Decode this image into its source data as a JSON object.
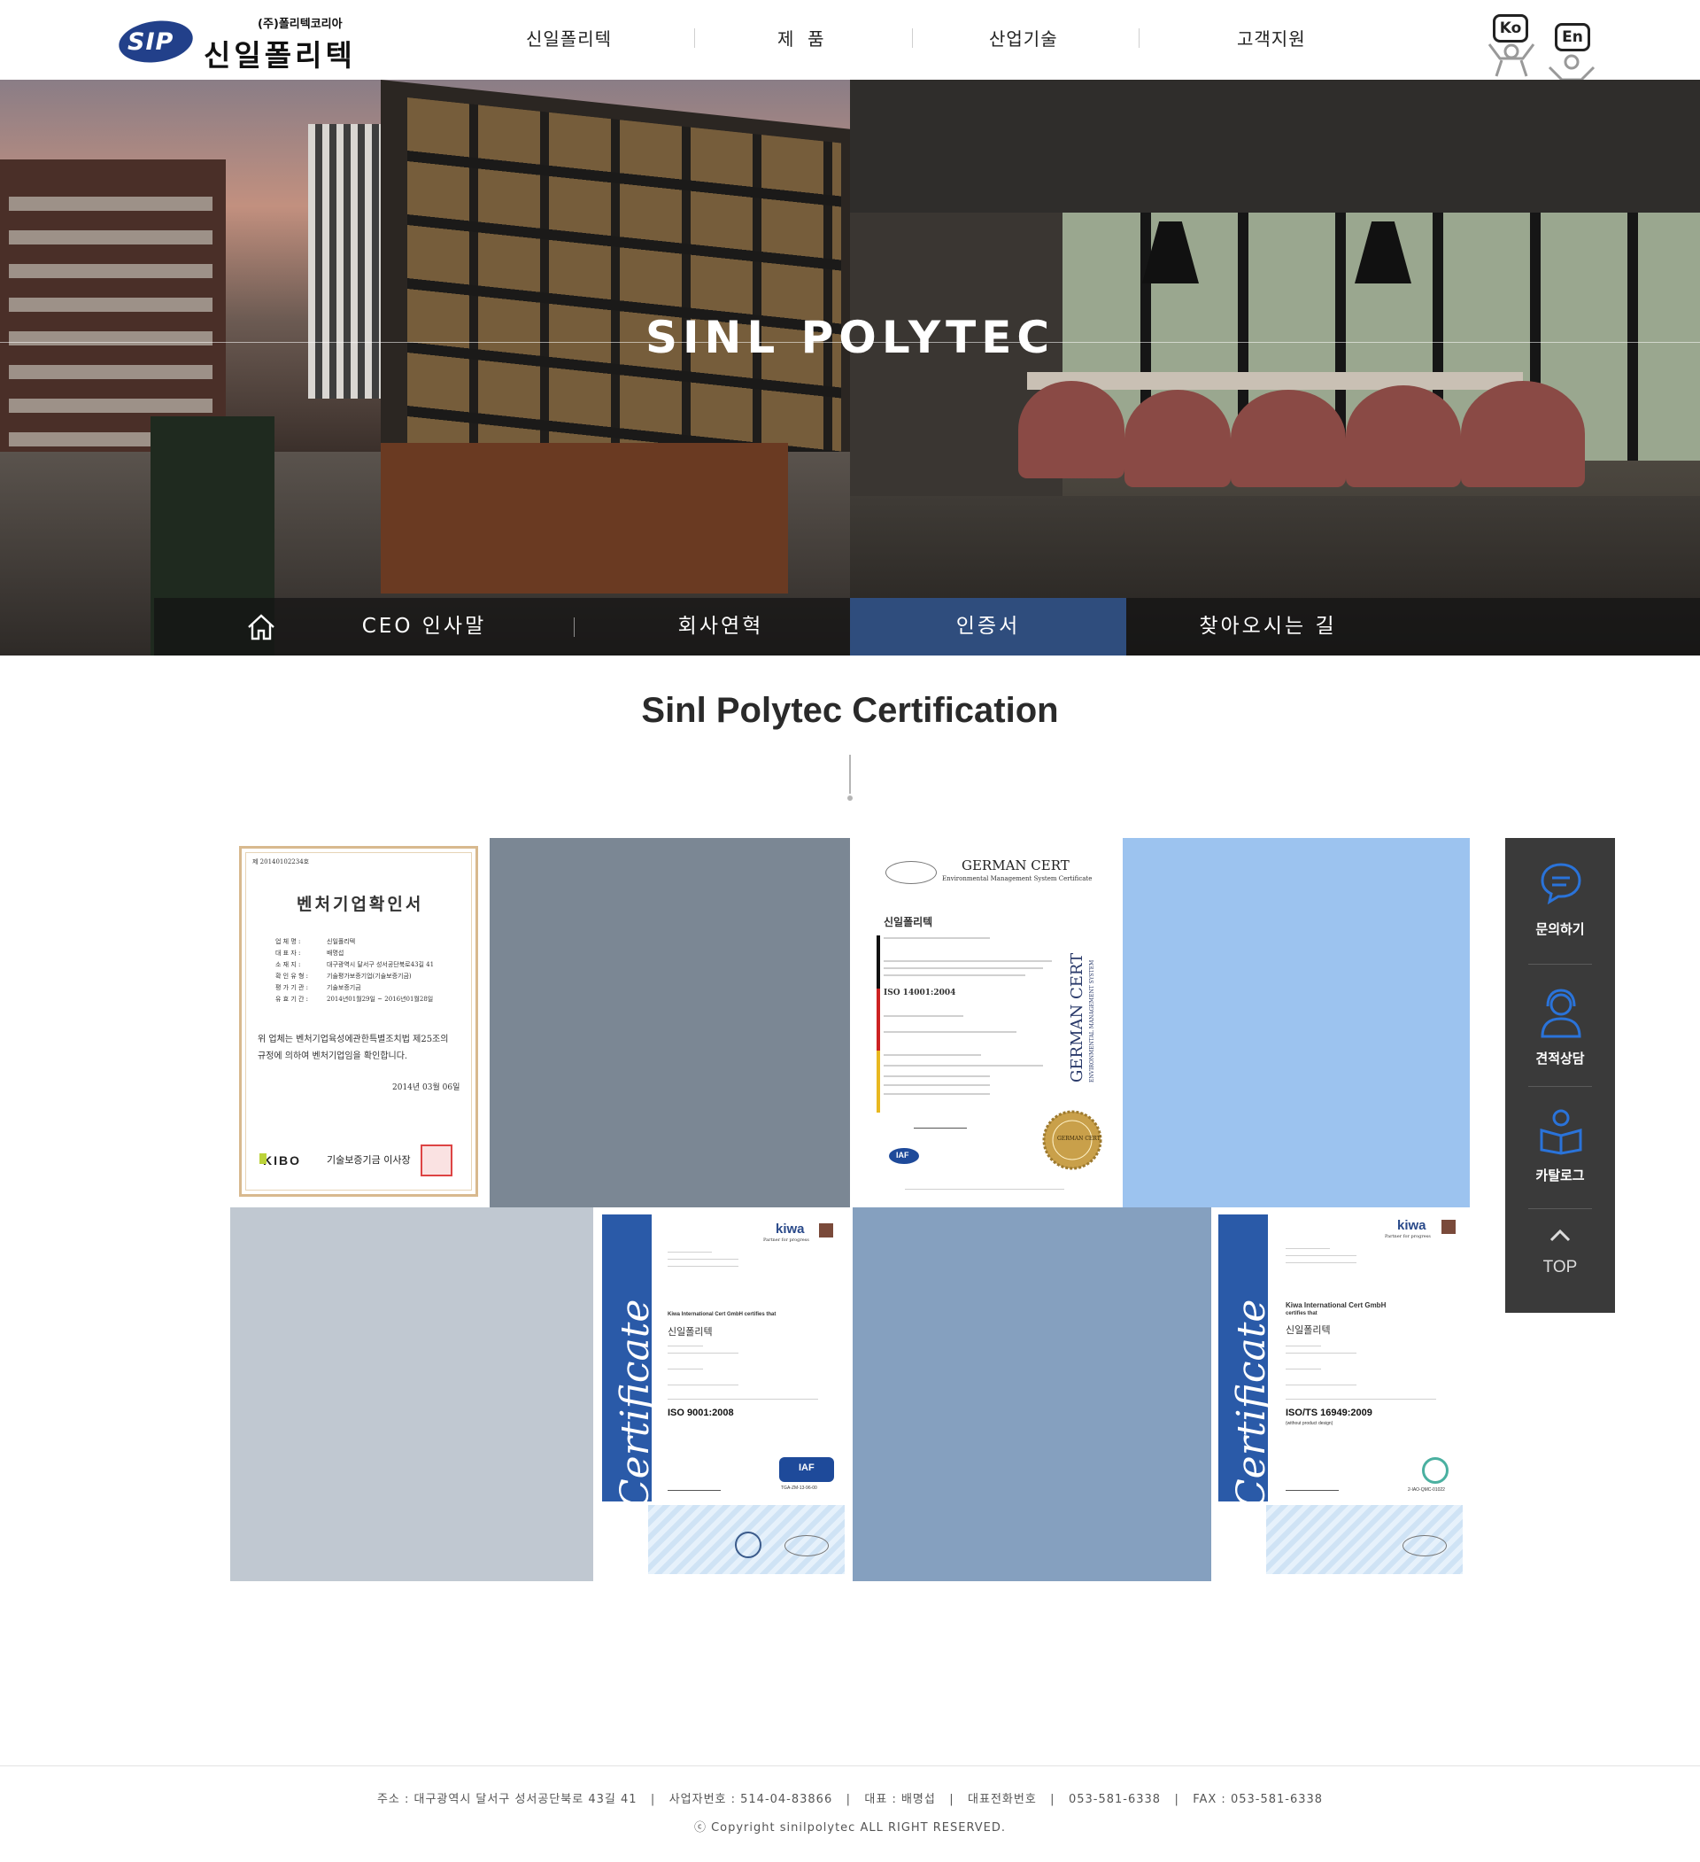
{
  "header": {
    "logo": {
      "badge": "SIP",
      "corp": "(주)폴리텍코리아",
      "name": "신일폴리텍"
    },
    "nav": [
      "신일폴리텍",
      "제  품",
      "산업기술",
      "고객지원"
    ],
    "lang": [
      "Ko",
      "En"
    ]
  },
  "hero": {
    "title": "SINL POLYTEC",
    "subnav": [
      "CEO 인사말",
      "회사연혁",
      "인증서",
      "찾아오시는 길"
    ],
    "active_index": 2
  },
  "content": {
    "title": "Sinl Polytec Certification",
    "tile_colors": [
      "#7b8794",
      "#9cc3ef",
      "#c0c8d1",
      "#85a0bf"
    ],
    "certs": {
      "venture": {
        "number": "제   20140102234호",
        "title": "벤처기업확인서",
        "rows": [
          [
            "업   체   명 :",
            "신일폴리텍"
          ],
          [
            "대   표   자 :",
            "배명섭"
          ],
          [
            "소   재   지 :",
            "대구광역시 달서구 성서공단북로43길 41"
          ],
          [
            "확 인 유 형 :",
            "기술평가보증기업(기술보증기금)"
          ],
          [
            "평 가 기 관 :",
            "기술보증기금"
          ],
          [
            "유 효 기 간 :",
            "2014년01월29일 ~ 2016년01월28일"
          ]
        ],
        "body1": "위 업체는 벤처기업육성에관한특별조치법 제25조의",
        "body2": "규정에 의하여 벤처기업임을 확인합니다.",
        "date": "2014년  03월  06일",
        "issuer_logo": "KIBO",
        "issuer": "기술보증기금 이사장"
      },
      "german": {
        "header": "GERMAN CERT",
        "subheader": "Environmental Management System Certificate",
        "company": "신일폴리텍",
        "standard": "ISO 14001:2004",
        "side": "GERMAN CERT",
        "side_sub": "ENVIRONMENTAL MANAGEMENT SYSTEM",
        "seal": "GERMAN CERT",
        "iaf": "IAF"
      },
      "kiwa1": {
        "brand": "kiwa",
        "tagline": "Partner for progress",
        "side": "Certificate",
        "issuer_line": "Kiwa International Cert GmbH certifies that",
        "company": "신일폴리텍",
        "standard": "ISO 9001:2008",
        "code": "TGA-ZM-13-96-00",
        "iaf": "IAF"
      },
      "kiwa2": {
        "brand": "kiwa",
        "tagline": "Partner for progress",
        "side": "Certificate",
        "issuer_line": "Kiwa International Cert GmbH",
        "issuer_line2": "certifies that",
        "company": "신일폴리텍",
        "standard": "ISO/TS 16949:2009",
        "standard_note": "(without product design)",
        "code": "2-IAO-QMC-01022"
      }
    }
  },
  "quick_menu": {
    "items": [
      "문의하기",
      "견적상담",
      "카탈로그"
    ],
    "top": "TOP",
    "icon_color": "#2a73d9"
  },
  "footer": {
    "info": "주소 : 대구광역시 달서구 성서공단북로 43길 41   |   사업자번호 : 514-04-83866   |   대표 : 배명섭   |   대표전화번호   |   053-581-6338   |   FAX : 053-581-6338",
    "copyright": "ⓒ Copyright sinilpolytec ALL RIGHT RESERVED."
  }
}
